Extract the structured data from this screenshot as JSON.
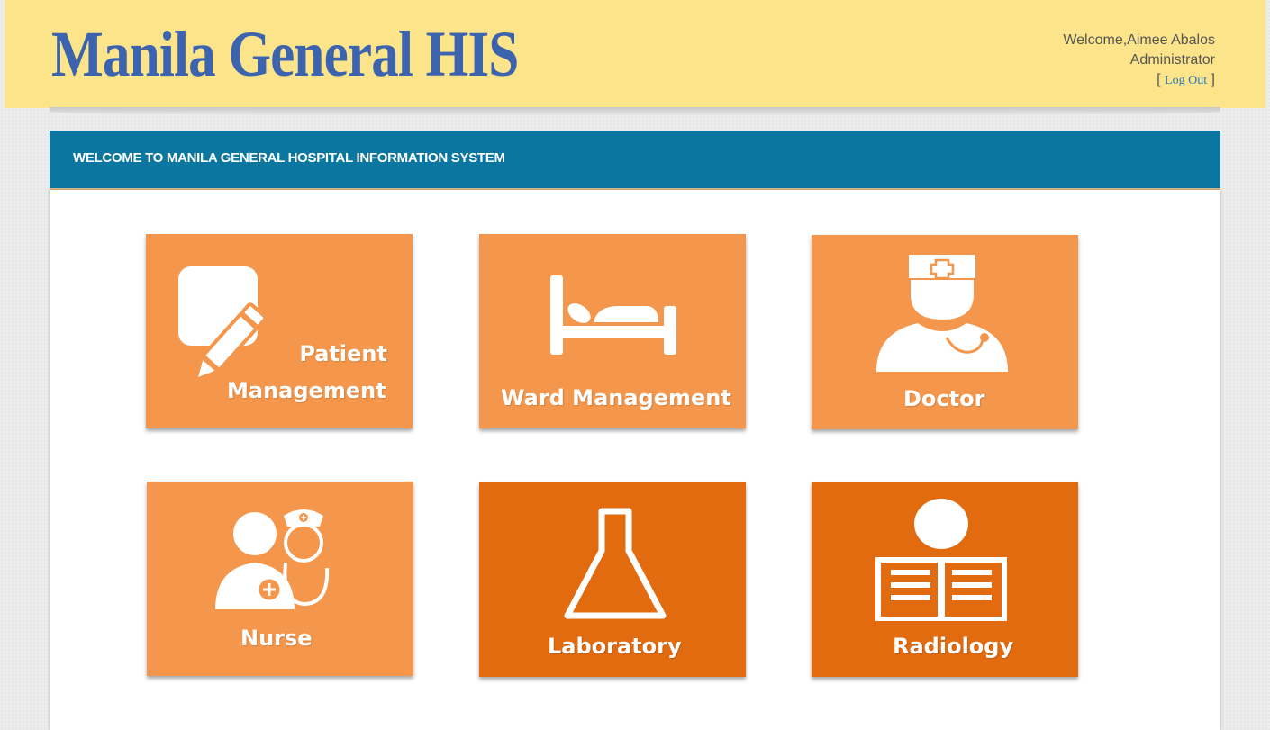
{
  "header": {
    "logo_text": "Manila General HIS",
    "welcome_text": "Welcome,Aimee Abalos",
    "role_text": "Administrator",
    "logout_label": "Log Out",
    "bracket_open": "[",
    "bracket_close": "]"
  },
  "banner": {
    "title": "WELCOME TO MANILA GENERAL HOSPITAL INFORMATION SYSTEM"
  },
  "modules": [
    {
      "label_line1": "Patient",
      "label_line2": "Management",
      "icon": "note-pencil-icon"
    },
    {
      "label": "Ward Management",
      "icon": "bed-icon"
    },
    {
      "label": "Doctor",
      "icon": "doctor-icon"
    },
    {
      "label": "Nurse",
      "icon": "nurse-icon"
    },
    {
      "label": "Laboratory",
      "icon": "flask-icon"
    },
    {
      "label": "Radiology",
      "icon": "radiology-icon"
    }
  ],
  "colors": {
    "header_bg": "#fce48b",
    "logo": "#3c63ad",
    "banner_bg": "#0b77a1",
    "tile_light": "#f4964b",
    "tile_dark": "#e26b10"
  }
}
